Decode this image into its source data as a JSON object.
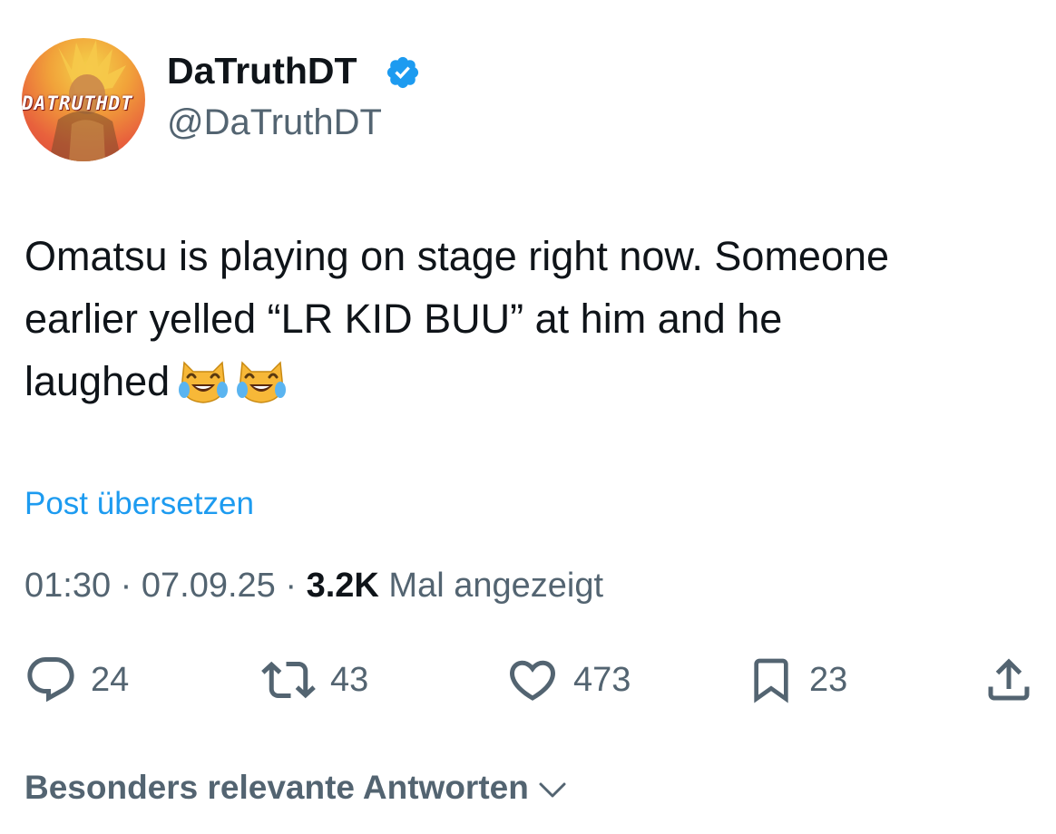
{
  "author": {
    "display_name": "DaTruthDT",
    "handle": "@DaTruthDT",
    "avatar_text": "DATRUTHDT",
    "verified": true,
    "verified_color": "#1d9bf0"
  },
  "tweet": {
    "lines": [
      "Omatsu is playing on stage right now. Someone",
      "earlier yelled “LR KID BUU” at him and he",
      "laughed"
    ],
    "emojis": [
      "cat-tears-of-joy-emoji",
      "cat-tears-of-joy-emoji"
    ]
  },
  "translate_label": "Post übersetzen",
  "meta": {
    "time": "01:30",
    "date": "07.09.25",
    "separator": "·",
    "views": "3.2K",
    "views_label": "Mal angezeigt"
  },
  "actions": {
    "reply": {
      "icon": "reply-icon",
      "count": "24"
    },
    "retweet": {
      "icon": "retweet-icon",
      "count": "43"
    },
    "like": {
      "icon": "heart-icon",
      "count": "473"
    },
    "bookmark": {
      "icon": "bookmark-icon",
      "count": "23"
    },
    "share": {
      "icon": "share-icon"
    }
  },
  "replies_sort_label": "Besonders relevante Antworten",
  "colors": {
    "text": "#0f1419",
    "secondary": "#536471",
    "link": "#1d9bf0"
  }
}
